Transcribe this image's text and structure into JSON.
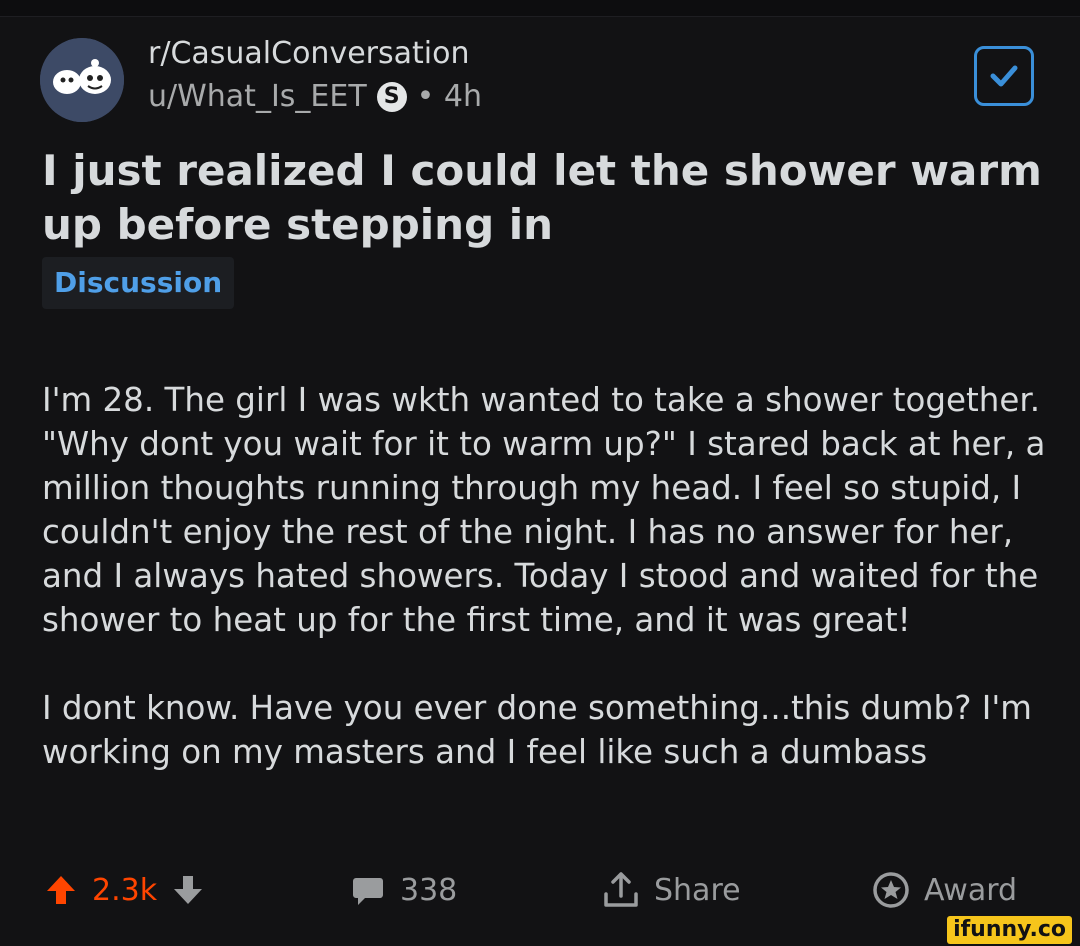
{
  "post": {
    "subreddit": "r/CasualConversation",
    "username": "u/What_Is_EET",
    "user_badge": "S",
    "age": "• 4h",
    "title": "I just realized I could let the shower warm up before stepping in",
    "flair": "Discussion",
    "body_paragraphs": [
      "I'm 28. The girl I was wkth wanted to take a shower together. \"Why dont you wait for it to warm up?\" I stared back at her, a million thoughts running through my head. I feel so stupid, I couldn't enjoy the rest of the night. I has no answer for her, and I always hated showers. Today I stood and waited for the shower to heat up for the first time, and it was great!",
      "I dont know. Have you ever done something...this dumb? I'm working on my masters and I feel like such a dumbass"
    ]
  },
  "actions": {
    "score": "2.3k",
    "comments": "338",
    "share_label": "Share",
    "award_label": "Award"
  },
  "colors": {
    "upvote": "#ff4500",
    "accent_blue": "#3a8fd9",
    "background": "#121214"
  },
  "watermark": "ifunny.co"
}
